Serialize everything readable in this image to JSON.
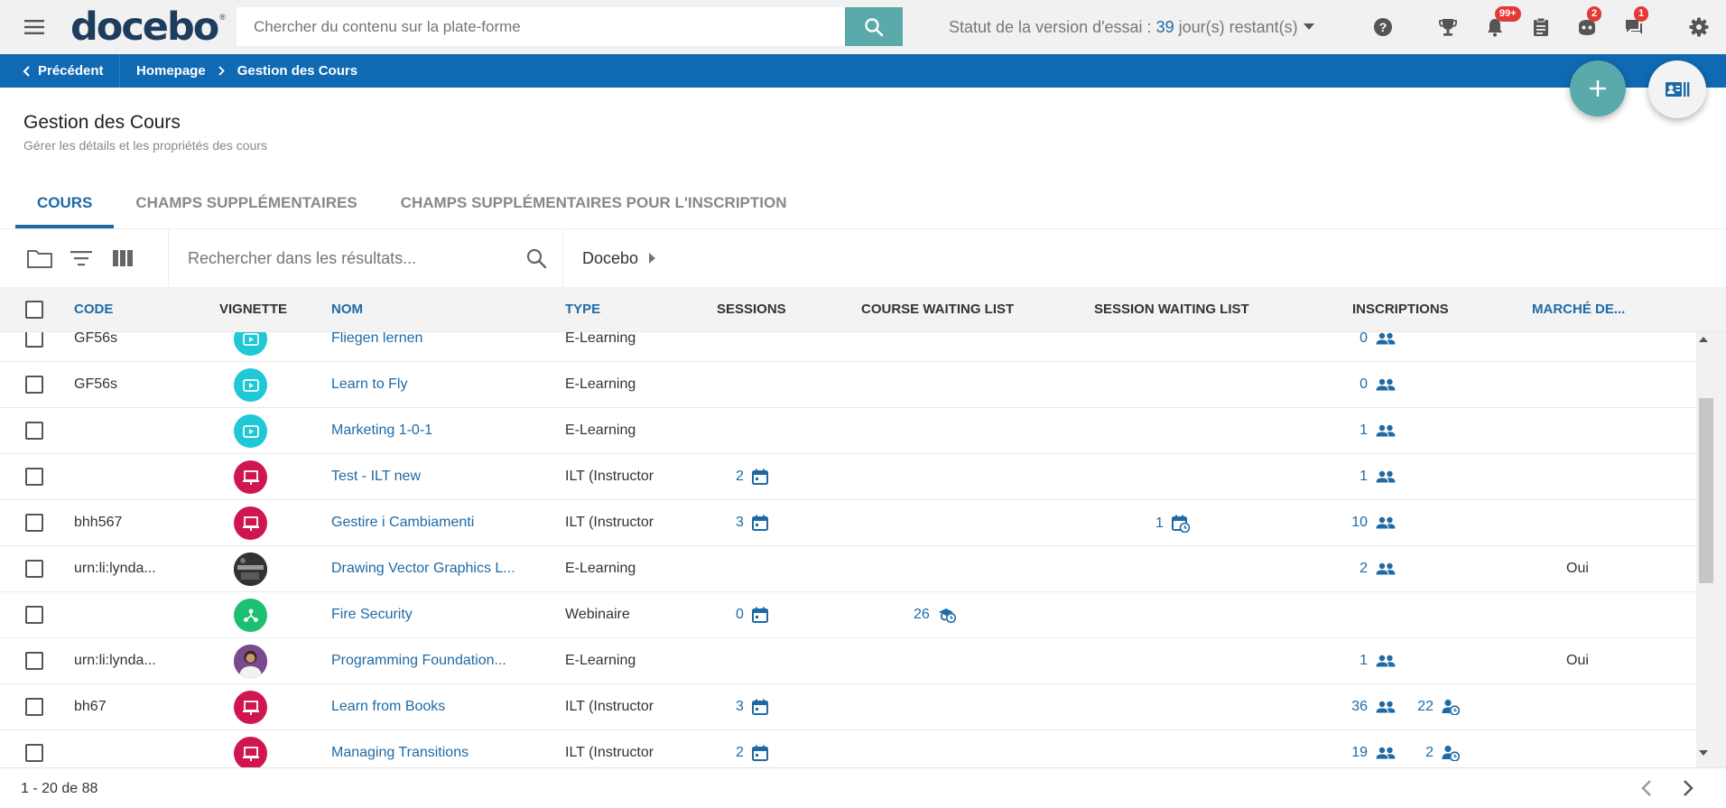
{
  "header": {
    "logo_text": "docebo",
    "logo_mark": "®",
    "search_placeholder": "Chercher du contenu sur la plate-forme",
    "trial_prefix": "Statut de la version d'essai :",
    "trial_days": "39",
    "trial_suffix": "jour(s) restant(s)",
    "badges": {
      "notifications": "99+",
      "messages": "2",
      "chat": "1"
    }
  },
  "navbar": {
    "back_label": "Précédent",
    "breadcrumb_home": "Homepage",
    "breadcrumb_current": "Gestion des Cours"
  },
  "page": {
    "title": "Gestion des Cours",
    "subtitle": "Gérer les détails et les propriétés des cours"
  },
  "tabs": [
    {
      "label": "COURS",
      "active": true
    },
    {
      "label": "CHAMPS SUPPLÉMENTAIRES",
      "active": false
    },
    {
      "label": "CHAMPS SUPPLÉMENTAIRES POUR L'INSCRIPTION",
      "active": false
    }
  ],
  "toolbar": {
    "search_placeholder": "Rechercher dans les résultats...",
    "folder_label": "Docebo"
  },
  "table": {
    "columns": {
      "code": "CODE",
      "thumbnail": "VIGNETTE",
      "name": "NOM",
      "type": "TYPE",
      "sessions": "SESSIONS",
      "course_waiting": "COURSE WAITING LIST",
      "session_waiting": "SESSION WAITING LIST",
      "enrollments": "INSCRIPTIONS",
      "marketplace": "MARCHÉ DE..."
    },
    "rows": [
      {
        "code": "GF56s",
        "thumb": "elearning",
        "name": "Fliegen lernen",
        "type": "E-Learning",
        "sessions": "",
        "course_waiting": "",
        "session_waiting": "",
        "enrollments": "0",
        "enroll_waiting": "",
        "marketplace": ""
      },
      {
        "code": "GF56s",
        "thumb": "elearning",
        "name": "Learn to Fly",
        "type": "E-Learning",
        "sessions": "",
        "course_waiting": "",
        "session_waiting": "",
        "enrollments": "0",
        "enroll_waiting": "",
        "marketplace": ""
      },
      {
        "code": "",
        "thumb": "elearning",
        "name": "Marketing 1-0-1",
        "type": "E-Learning",
        "sessions": "",
        "course_waiting": "",
        "session_waiting": "",
        "enrollments": "1",
        "enroll_waiting": "",
        "marketplace": ""
      },
      {
        "code": "",
        "thumb": "ilt",
        "name": "Test - ILT new",
        "type": "ILT (Instructor",
        "sessions": "2",
        "course_waiting": "",
        "session_waiting": "",
        "enrollments": "1",
        "enroll_waiting": "",
        "marketplace": ""
      },
      {
        "code": "bhh567",
        "thumb": "ilt",
        "name": "Gestire i Cambiamenti",
        "type": "ILT (Instructor",
        "sessions": "3",
        "course_waiting": "",
        "session_waiting": "1",
        "enrollments": "10",
        "enroll_waiting": "",
        "marketplace": ""
      },
      {
        "code": "urn:li:lynda...",
        "thumb": "photo-dark",
        "name": "Drawing Vector Graphics L...",
        "type": "E-Learning",
        "sessions": "",
        "course_waiting": "",
        "session_waiting": "",
        "enrollments": "2",
        "enroll_waiting": "",
        "marketplace": "Oui"
      },
      {
        "code": "",
        "thumb": "webinar",
        "name": "Fire Security",
        "type": "Webinaire",
        "sessions": "0",
        "course_waiting": "26",
        "session_waiting": "",
        "enrollments": "",
        "enroll_waiting": "",
        "marketplace": ""
      },
      {
        "code": "urn:li:lynda...",
        "thumb": "photo-person",
        "name": "Programming Foundation...",
        "type": "E-Learning",
        "sessions": "",
        "course_waiting": "",
        "session_waiting": "",
        "enrollments": "1",
        "enroll_waiting": "",
        "marketplace": "Oui"
      },
      {
        "code": "bh67",
        "thumb": "ilt",
        "name": "Learn from Books",
        "type": "ILT (Instructor",
        "sessions": "3",
        "course_waiting": "",
        "session_waiting": "",
        "enrollments": "36",
        "enroll_waiting": "22",
        "marketplace": ""
      },
      {
        "code": "",
        "thumb": "ilt",
        "name": "Managing Transitions",
        "type": "ILT (Instructor",
        "sessions": "2",
        "course_waiting": "",
        "session_waiting": "",
        "enrollments": "19",
        "enroll_waiting": "2",
        "marketplace": ""
      }
    ]
  },
  "footer": {
    "pagination_text": "1 - 20 de 88"
  },
  "colors": {
    "brand_blue": "#0f69b3",
    "link_blue": "#1f6aa5",
    "teal": "#5aa9ab",
    "elearning_thumb": "#1ec8d4",
    "ilt_thumb": "#d0164f",
    "webinar_thumb": "#1dbf73",
    "badge_red": "#e53935"
  }
}
